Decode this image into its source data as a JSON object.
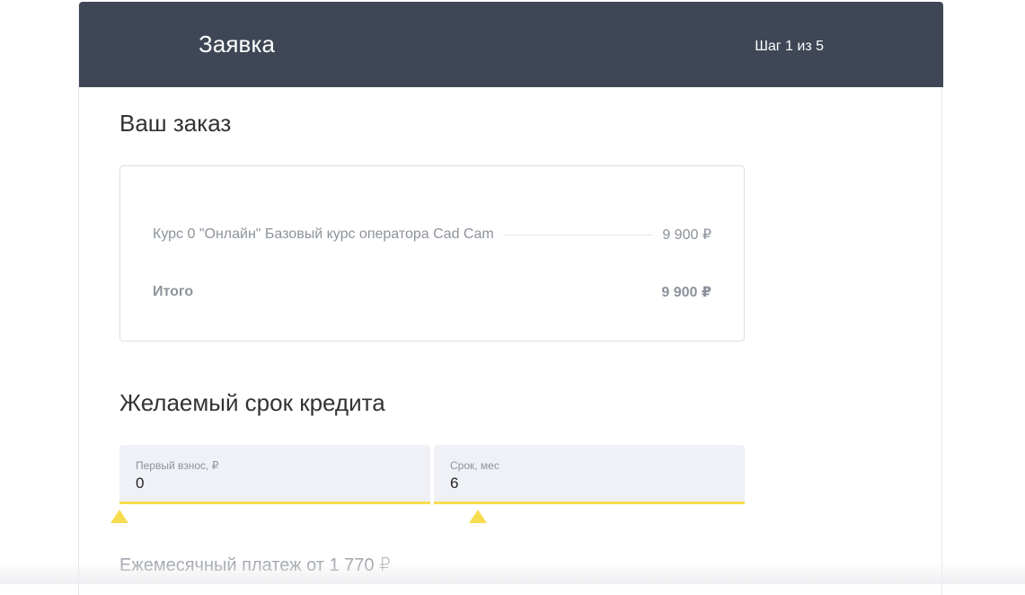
{
  "header": {
    "title": "Заявка",
    "step": "Шаг 1 из 5"
  },
  "order": {
    "title": "Ваш заказ",
    "item": {
      "name": "Курс 0 \"Онлайн\" Базовый курс оператора Cad Cam",
      "price": "9 900 ₽"
    },
    "total": {
      "label": "Итого",
      "value": "9 900 ₽"
    }
  },
  "credit": {
    "title": "Желаемый срок кредита",
    "down_payment": {
      "label": "Первый взнос, ₽",
      "value": "0"
    },
    "term": {
      "label": "Срок, мес",
      "value": "6"
    },
    "monthly_payment": "Ежемесячный платеж от 1 770 ₽"
  },
  "colors": {
    "header_bg": "#3f4756",
    "accent": "#f7dc4f",
    "field_bg": "#eff1f6"
  }
}
